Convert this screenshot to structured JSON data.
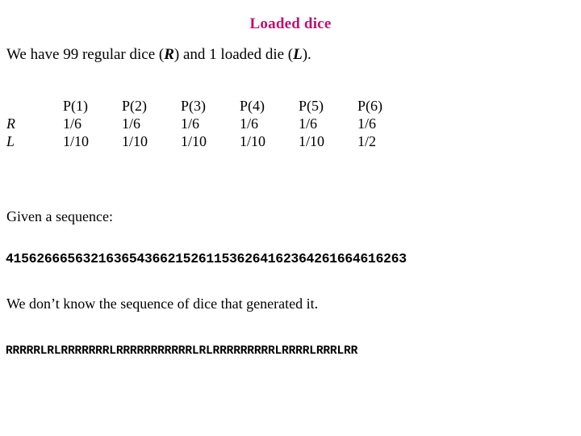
{
  "slide": {
    "title": "Loaded dice",
    "title_color": "#C2106E",
    "background_color": "#FFFFFF",
    "text_color": "#000000"
  },
  "intro": {
    "part1": "We have 99 regular dice (",
    "regular_symbol": "R",
    "part2": ") and 1 loaded die (",
    "loaded_symbol": "L",
    "part3": ")."
  },
  "table": {
    "corner_label": "",
    "headers": [
      "P(1)",
      "P(2)",
      "P(3)",
      "P(4)",
      "P(5)",
      "P(6)"
    ],
    "rows": [
      {
        "label": "R",
        "values": [
          "1/6",
          "1/6",
          "1/6",
          "1/6",
          "1/6",
          "1/6"
        ]
      },
      {
        "label": "L",
        "values": [
          "1/10",
          "1/10",
          "1/10",
          "1/10",
          "1/10",
          "1/2"
        ]
      }
    ]
  },
  "given_label": "Given a sequence:",
  "digit_sequence": "4156266656321636543662152611536264162364261664616263",
  "dontknow_label": "We don’t know the sequence of dice that generated it.",
  "dice_sequence": "RRRRRLRLRRRRRRRLRRRRRRRRRRRLRLRRRRRRRRRLRRRRLRRRLRR"
}
